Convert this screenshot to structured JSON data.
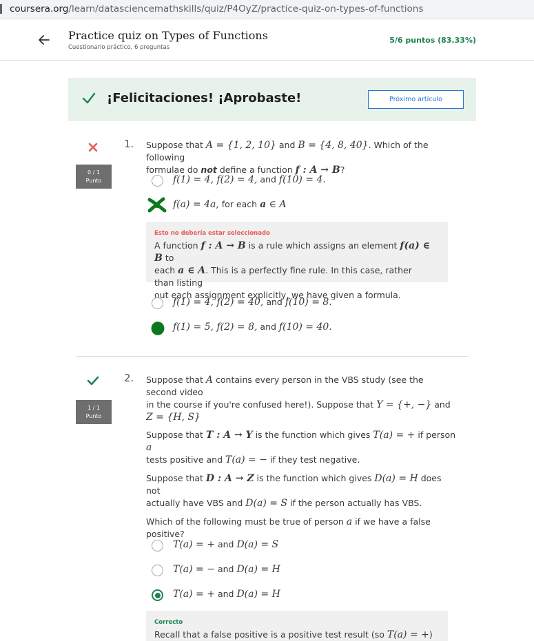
{
  "browser": {
    "url_host": "coursera.org",
    "url_path": "/learn/datasciencemathskills/quiz/P4OyZ/practice-quiz-on-types-of-functions"
  },
  "header": {
    "title": "Practice quiz on Types of Functions",
    "subtitle": "Cuestionario práctico, 6 preguntas",
    "score": "5/6 puntos (83.33%)"
  },
  "banner": {
    "message": "¡Felicitaciones! ¡Aprobaste!",
    "next_button": "Próximo artículo"
  },
  "colors": {
    "correct_green": "#1f8354",
    "banner_bg": "#e6f2ea",
    "wrong_red": "#e85a5a",
    "link_blue": "#2a73cc"
  },
  "questions": [
    {
      "number": "1.",
      "status": "incorrect",
      "points_line1": "0 / 1",
      "points_line2": "Punto",
      "text": {
        "t1": "Suppose that ",
        "t2": " and ",
        "t3": ". Which of the following",
        "t4": "formulae do ",
        "t4_em": "not",
        "t5": " define a function ",
        "t6": "?",
        "m_A": "A = {1, 2, 10}",
        "m_B": "B = {4, 8, 40}",
        "m_f": "f : A → B"
      },
      "options": [
        {
          "m1": "f(1) = 4, f(2) = 4,",
          "t1": " and ",
          "m2": "f(10) = 4.",
          "state": "unselected"
        },
        {
          "m1": "f(a) = 4a,",
          "t1": " for each ",
          "m2": "a",
          "t2": " ∈ ",
          "m3": "A",
          "state": "selected-wrong"
        },
        {
          "m1": "f(1) = 4, f(2) = 40,",
          "t1": " and ",
          "m2": "f(10) = 8.",
          "state": "unselected"
        },
        {
          "m1": "f(1) = 5, f(2) = 8,",
          "t1": " and ",
          "m2": "f(10) = 40.",
          "state": "selected-correct"
        }
      ],
      "feedback": {
        "label": "Esto no debería estar seleccionado",
        "l1a": "A function ",
        "l1m1": "f : A → B",
        "l1b": " is a rule which assigns an element ",
        "l1m2": "f(a) ∈ B",
        "l1c": " to",
        "l2a": "each ",
        "l2m": "a ∈ A",
        "l2b": ". This is a perfectly fine rule. In this case, rather than listing",
        "l3": "out each assignment explicitly, we have given a formula."
      }
    },
    {
      "number": "2.",
      "status": "correct",
      "points_line1": "1 / 1",
      "points_line2": "Punto",
      "p1": {
        "a": "Suppose that ",
        "m1": "A",
        "b": " contains every person in the VBS study (see the second video",
        "c": "in the course if you're confused here!). Suppose that ",
        "m2": "Y = {+, −}",
        "d": " and",
        "m3": "Z = {H, S}"
      },
      "p2": {
        "a": "Suppose that ",
        "m1": "T : A → Y",
        "b": " is the function which gives ",
        "m2": "T(a) = +",
        "c": " if person ",
        "m3": "a",
        "d": "tests positive and ",
        "m4": "T(a) = −",
        "e": " if they test negative."
      },
      "p3": {
        "a": "Suppose that ",
        "m1": "D : A → Z",
        "b": " is the function which gives ",
        "m2": "D(a) = H",
        "c": " does not",
        "d": "actually have VBS and ",
        "m3": "D(a) = S",
        "e": " if the person actually has VBS."
      },
      "p4": {
        "a": "Which of the following must be true of person ",
        "m1": "a",
        "b": " if we have a false positive?"
      },
      "options": [
        {
          "m1": "T(a) = +",
          "t1": " and ",
          "m2": "D(a) = S",
          "state": "unselected"
        },
        {
          "m1": "T(a) = −",
          "t1": " and ",
          "m2": "D(a) = H",
          "state": "unselected"
        },
        {
          "m1": "T(a) = +",
          "t1": " and ",
          "m2": "D(a) = H",
          "state": "selected-correct"
        }
      ],
      "feedback": {
        "label": "Correcto",
        "a": "Recall that a false positive is a positive test result (so ",
        "m1": "T(a) = +",
        "b": ") which"
      }
    }
  ]
}
